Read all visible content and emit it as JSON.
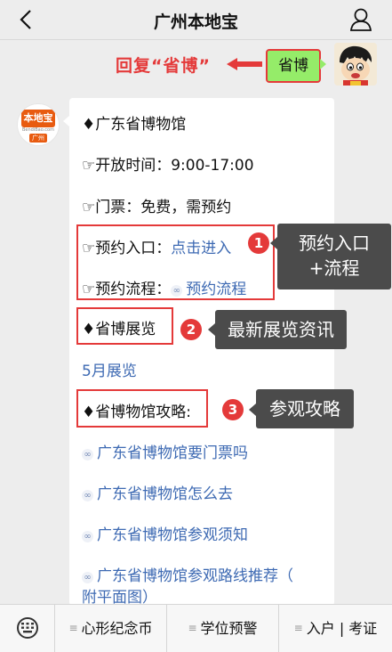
{
  "header": {
    "title": "广州本地宝",
    "back_icon": "chevron-left-icon",
    "profile_icon": "person-icon"
  },
  "hint": {
    "text": "回复“省博”",
    "color": "#e43a3a"
  },
  "sent_message": {
    "text": "省博",
    "bubble_color": "#95ec69"
  },
  "bot": {
    "avatar_logo_text": "本地宝",
    "avatar_sub_text": "BendiBao.com",
    "avatar_city": "广州"
  },
  "reply": {
    "museum_line": "♦广东省博物馆",
    "hours_line": "☞开放时间：9:00-17:00",
    "ticket_line": "☞门票：免费，需预约",
    "entry_label": "☞预约入口：",
    "entry_link": "点击进入",
    "process_label": "☞预约流程：",
    "process_link": "预约流程",
    "exhibition_heading": "♦省博展览",
    "exhibition_link": "5月展览",
    "guide_heading": "♦省博物馆攻略:",
    "guide_links": [
      "广东省博物馆要门票吗",
      "广东省博物馆怎么去",
      "广东省博物馆参观须知",
      "广东省博物馆参观路线推荐（",
      "附平面图）"
    ]
  },
  "annotations": {
    "badge_1": "1",
    "callout_1_line1": "预约入口",
    "callout_1_line2": "+流程",
    "badge_2": "2",
    "callout_2": "最新展览资讯",
    "badge_3": "3",
    "callout_3": "参观攻略",
    "accent_color": "#e43a3a"
  },
  "bottom_menu": {
    "keyboard_icon": "keyboard-icon",
    "items": [
      {
        "label": "心形纪念币"
      },
      {
        "label": "学位预警"
      },
      {
        "label": "入户 | 考证"
      }
    ]
  }
}
